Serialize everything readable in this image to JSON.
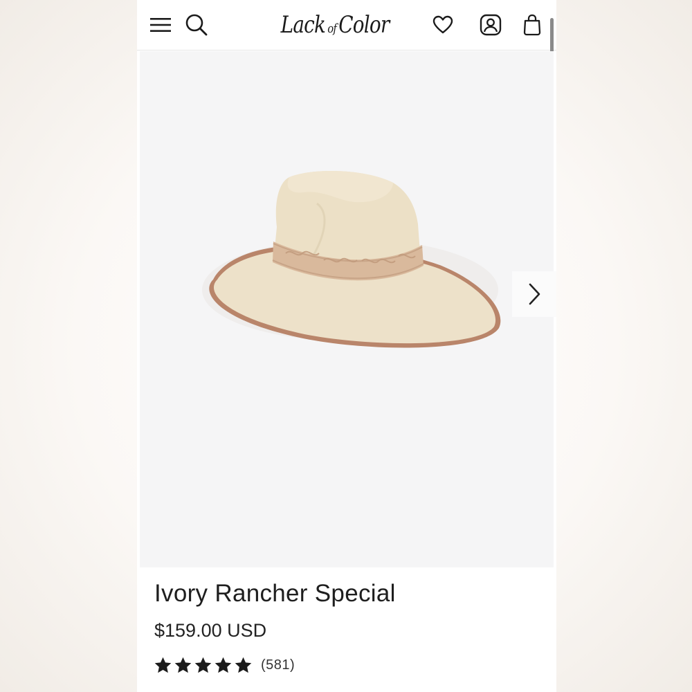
{
  "header": {
    "brand": {
      "name": "Lack of Color",
      "word1": "Lack",
      "word2": "of",
      "word3": "Color"
    },
    "icons": {
      "menu": "hamburger-menu-icon",
      "search": "search-icon",
      "wishlist": "heart-icon",
      "account": "user-account-icon",
      "cart": "shopping-bag-icon"
    }
  },
  "gallery": {
    "next_icon": "chevron-right-icon",
    "image_subject": "ivory wide-brim rancher hat"
  },
  "product": {
    "title": "Ivory Rancher Special",
    "price": "$159.00 USD",
    "rating_stars": 5,
    "review_count": "(581)"
  },
  "colors": {
    "hat_felt": "#ede1c9",
    "hat_band": "#d9b99c",
    "hat_trim": "#b9856a",
    "text": "#1e1e1e",
    "image_bg": "#f5f5f6"
  }
}
